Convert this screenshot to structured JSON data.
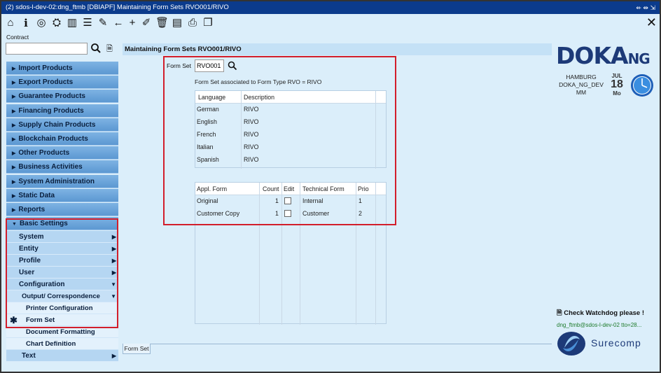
{
  "window": {
    "title": "(2) sdos-l-dev-02:dng_ftmb [DBIAPF] Maintaining Form Sets RVO001/RIVO",
    "controls": "⇷ ⇹ ⇲"
  },
  "contract": {
    "label": "Contract",
    "value": ""
  },
  "nav": {
    "items": [
      "Import Products",
      "Export Products",
      "Guarantee Products",
      "Financing Products",
      "Supply Chain Products",
      "Blockchain Products",
      "Other Products",
      "Business Activities",
      "System Administration",
      "Static Data",
      "Reports"
    ],
    "basic_settings": "Basic Settings",
    "sub_items": [
      "System",
      "Entity",
      "Profile",
      "User",
      "Configuration"
    ],
    "output_correspondence": "Output/ Correspondence",
    "printer_configuration": "Printer Configuration",
    "form_set": "Form Set",
    "document_formatting": "Document Formatting",
    "chart_definition": "Chart Definition",
    "text": "Text"
  },
  "content": {
    "header": "Maintaining Form Sets RVO001/RIVO",
    "form_set_label": "Form Set",
    "form_set_value": "RVO001",
    "assoc_text": "Form Set associated to Form Type RVO = RIVO",
    "lang_table": {
      "headers": [
        "Language",
        "Description"
      ],
      "rows": [
        [
          "German",
          "RIVO"
        ],
        [
          "English",
          "RIVO"
        ],
        [
          "French",
          "RIVO"
        ],
        [
          "Italian",
          "RIVO"
        ],
        [
          "Spanish",
          "RIVO"
        ]
      ]
    },
    "form_table": {
      "headers": [
        "Appl. Form",
        "Count",
        "Edit",
        "Technical Form",
        "Prio"
      ],
      "rows": [
        [
          "Original",
          "1",
          "",
          "Internal",
          "1"
        ],
        [
          "Customer Copy",
          "1",
          "",
          "Customer",
          "2"
        ]
      ]
    },
    "tab": "Form Set"
  },
  "brand": {
    "logo_main": "DOKA",
    "logo_sub": "NG",
    "location": [
      "HAMBURG",
      "DOKA_NG_DEV",
      "MM"
    ],
    "month": "JUL",
    "day": "18",
    "weekday": "Mo",
    "watchdog": "Check Watchdog please !",
    "user_line": "dng_ftmb@sdos-l-dev-02 tto=28...",
    "company": "Surecomp"
  }
}
